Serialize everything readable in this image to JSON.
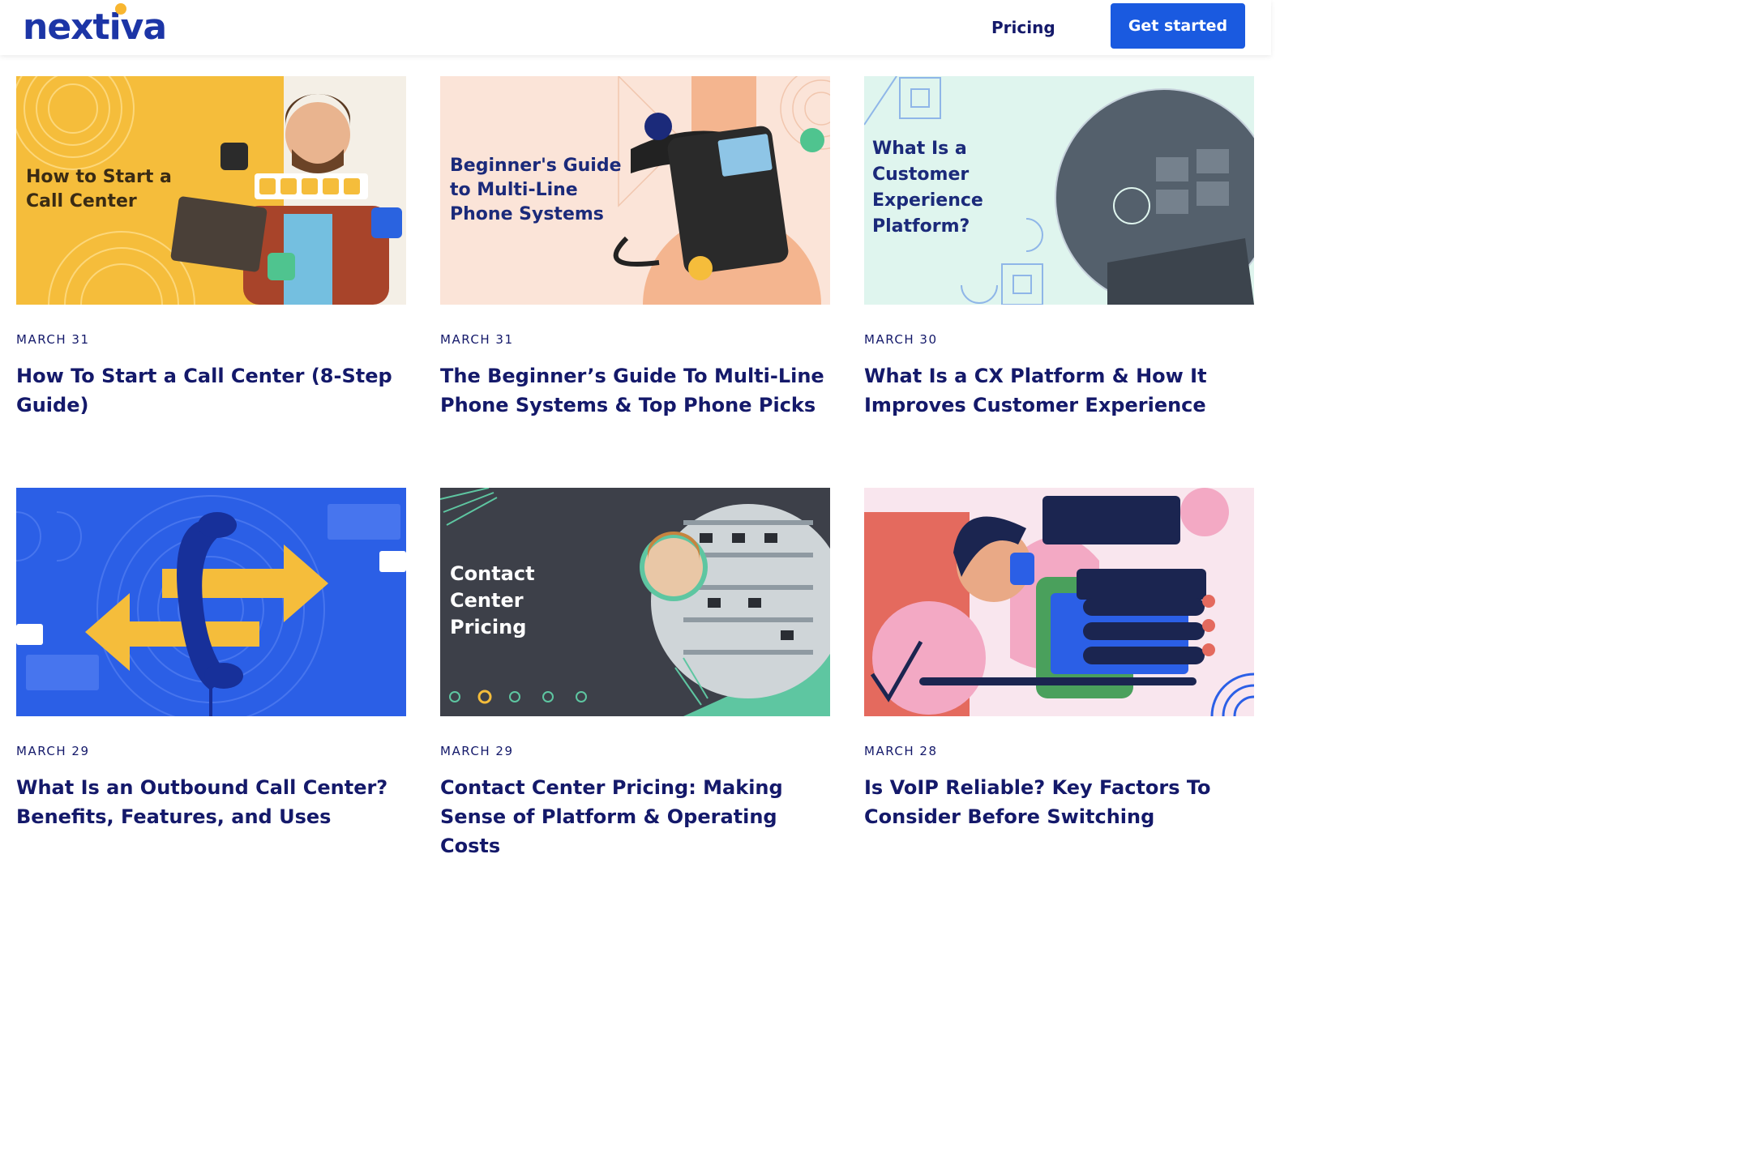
{
  "header": {
    "logo": "nextiva",
    "nav_pricing": "Pricing",
    "cta_label": "Get started",
    "cta_color": "#1a5ae0",
    "brand_color": "#1c35a6"
  },
  "posts": [
    {
      "date": "MARCH 31",
      "title": "How To Start a Call Center (8-Step Guide)",
      "image_text": "How to Start a Call Center"
    },
    {
      "date": "MARCH 31",
      "title": "The Beginner’s Guide To Multi-Line Phone Systems & Top Phone Picks",
      "image_text": "Beginner's Guide to Multi-Line Phone Systems"
    },
    {
      "date": "MARCH 30",
      "title": "What Is a CX Platform & How It Improves Customer Experience",
      "image_text": "What Is a Customer Experience Platform?"
    },
    {
      "date": "MARCH 29",
      "title": "What Is an Outbound Call Center? Benefits, Features, and Uses",
      "image_text": ""
    },
    {
      "date": "MARCH 29",
      "title": "Contact Center Pricing: Making Sense of Platform & Operating Costs",
      "image_text": "Contact Center Pricing"
    },
    {
      "date": "MARCH 28",
      "title": "Is VoIP Reliable? Key Factors To Consider Before Switching",
      "image_text": ""
    }
  ]
}
